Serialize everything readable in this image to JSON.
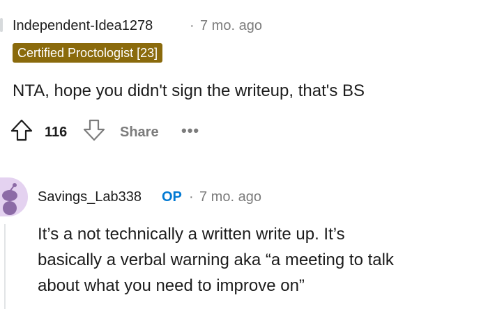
{
  "comments": [
    {
      "author": "Independent-Idea1278",
      "separator": "·",
      "time": "7 mo. ago",
      "flair": "Certified Proctologist [23]",
      "body": "NTA, hope you didn't sign the writeup, that's BS",
      "score": "116",
      "share_label": "Share",
      "more_label": "•••",
      "icons": [
        "upvote-icon",
        "downvote-icon",
        "more-icon"
      ]
    },
    {
      "author": "Savings_Lab338",
      "op_badge": "OP",
      "separator": "·",
      "time": "7 mo. ago",
      "body_lines": [
        "It’s a not technically a written write up. It’s",
        "basically a verbal warning aka “a meeting to talk",
        "about what you need to improve on”"
      ],
      "icons": [
        "snoo-avatar-icon"
      ]
    }
  ],
  "colors": {
    "flair_bg": "#8a6a0c",
    "op_blue": "#0079d3",
    "meta_gray": "#7c7c7c",
    "avatar_bg": "#e4d2f0"
  }
}
